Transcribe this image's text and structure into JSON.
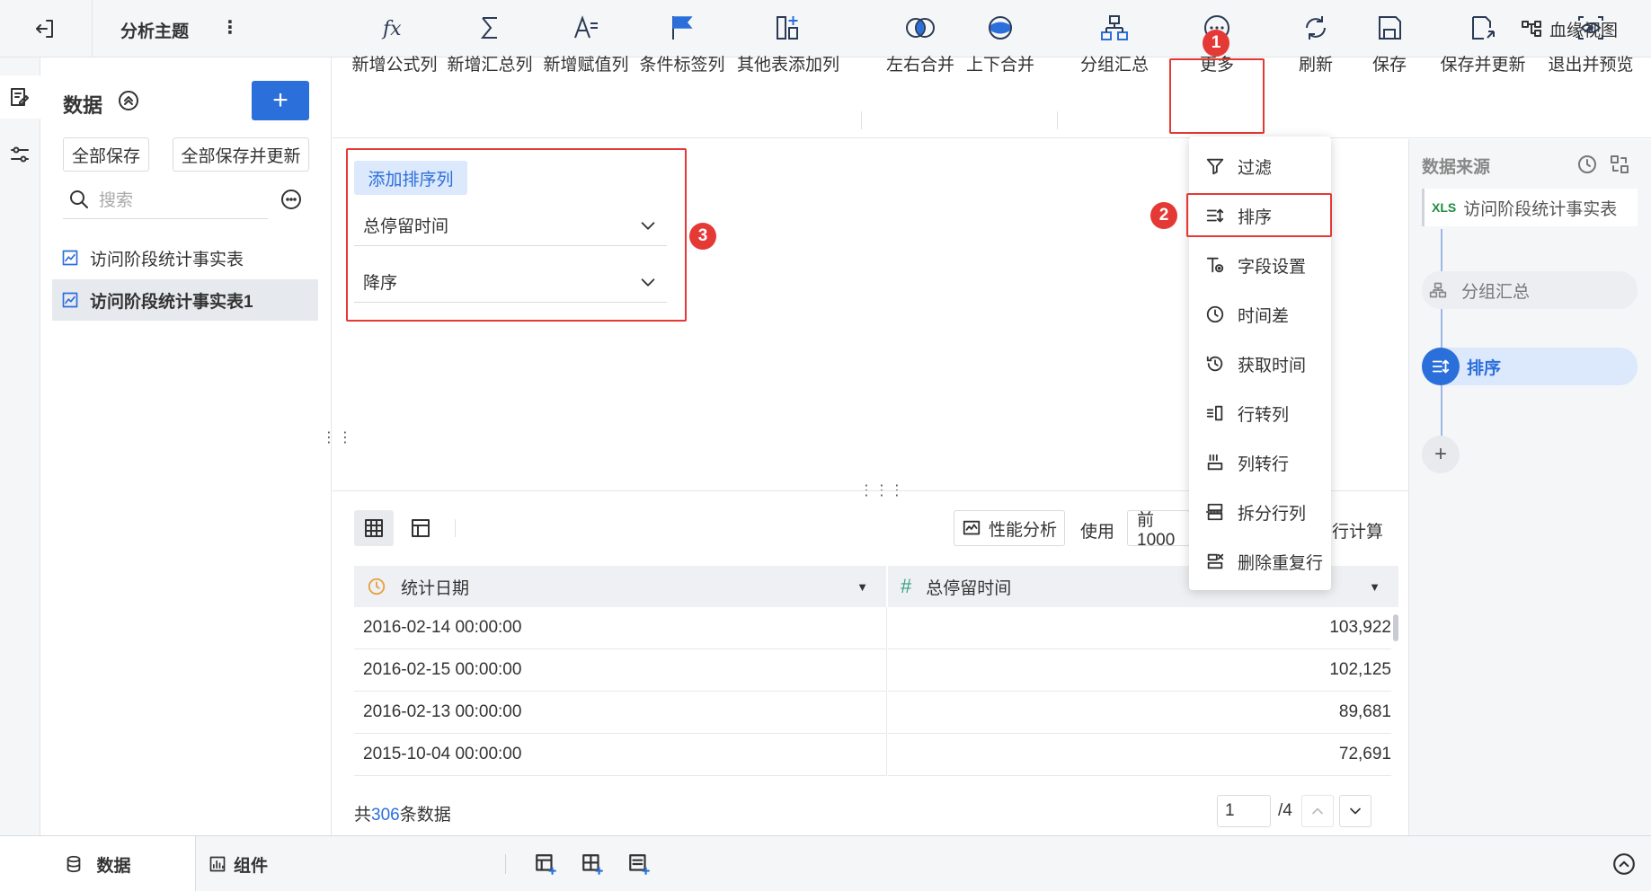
{
  "header": {
    "title": "分析主题",
    "lineage_label": "血缘视图"
  },
  "data_panel": {
    "title": "数据",
    "save_all": "全部保存",
    "save_all_update": "全部保存并更新",
    "search_placeholder": "搜索",
    "items": [
      {
        "label": "访问阶段统计事实表"
      },
      {
        "label": "访问阶段统计事实表1"
      }
    ]
  },
  "toolbar": {
    "formula": "新增公式列",
    "summary": "新增汇总列",
    "assign": "新增赋值列",
    "condition": "条件标签列",
    "other": "其他表添加列",
    "lr_merge": "左右合并",
    "ud_merge": "上下合并",
    "group": "分组汇总",
    "more": "更多",
    "refresh": "刷新",
    "save": "保存",
    "save_update": "保存并更新",
    "exit_preview": "退出并预览"
  },
  "sort_config": {
    "add_label": "添加排序列",
    "field": "总停留时间",
    "order": "降序"
  },
  "badges": {
    "b1": "1",
    "b2": "2",
    "b3": "3"
  },
  "more_menu": {
    "items": [
      {
        "label": "过滤"
      },
      {
        "label": "排序"
      },
      {
        "label": "字段设置"
      },
      {
        "label": "时间差"
      },
      {
        "label": "获取时间"
      },
      {
        "label": "行转列"
      },
      {
        "label": "列转行"
      },
      {
        "label": "拆分行列"
      },
      {
        "label": "删除重复行"
      }
    ]
  },
  "flow": {
    "title": "数据来源",
    "source_tag": "XLS",
    "source": "访问阶段统计事实表",
    "group": "分组汇总",
    "sort": "排序",
    "add": "+"
  },
  "preview": {
    "perf_label": "性能分析",
    "use_label": "使用",
    "rows_value": "前1000",
    "calc_label": "行计算",
    "columns": [
      {
        "label": "统计日期"
      },
      {
        "label": "总停留时间"
      }
    ],
    "rows": [
      {
        "date": "2016-02-14 00:00:00",
        "value": "103,922"
      },
      {
        "date": "2016-02-15 00:00:00",
        "value": "102,125"
      },
      {
        "date": "2016-02-13 00:00:00",
        "value": "89,681"
      },
      {
        "date": "2015-10-04 00:00:00",
        "value": "72,691"
      }
    ],
    "total_prefix": "共",
    "total_count": "306",
    "total_suffix": "条数据",
    "page_input": "1",
    "page_total": "/4"
  },
  "bottom": {
    "data_tab": "数据",
    "component_tab": "组件"
  },
  "colors": {
    "accent": "#2b6fdb",
    "badge": "#e53935",
    "selected_bg": "#dce8fb"
  }
}
